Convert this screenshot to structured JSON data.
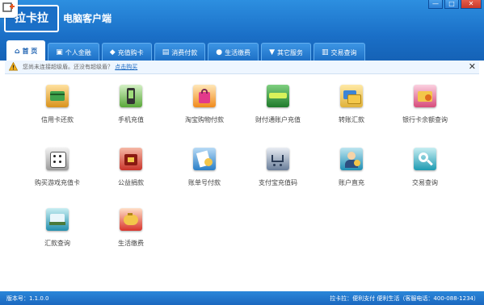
{
  "header": {
    "logo_text": "拉卡拉",
    "app_title": "电脑客户端"
  },
  "window_controls": {
    "minimize": "—",
    "maximize": "□",
    "close": "✕"
  },
  "tabs": [
    {
      "label": "首 页",
      "icon": "home-icon",
      "active": true
    },
    {
      "label": "个人金融",
      "icon": "wallet-icon",
      "active": false
    },
    {
      "label": "充值购卡",
      "icon": "card-icon",
      "active": false
    },
    {
      "label": "消费付款",
      "icon": "payment-icon",
      "active": false
    },
    {
      "label": "生活缴费",
      "icon": "bill-icon",
      "active": false
    },
    {
      "label": "其它服务",
      "icon": "chat-icon",
      "active": false
    },
    {
      "label": "交易查询",
      "icon": "query-icon",
      "active": false
    }
  ],
  "notice": {
    "text": "您尚未连接超级盾。还没有超级盾？",
    "link": "点击购买",
    "close": "✕"
  },
  "services": [
    {
      "label": "信用卡还款",
      "icon": "credit-card-icon",
      "color": "#e2a12c"
    },
    {
      "label": "手机充值",
      "icon": "mobile-icon",
      "color": "#5aa83a"
    },
    {
      "label": "淘宝购物付款",
      "icon": "shopping-bag-icon",
      "color": "#f08a1c"
    },
    {
      "label": "财付通账户充值",
      "icon": "tenpay-icon",
      "color": "#2e9a3b"
    },
    {
      "label": "转账汇款",
      "icon": "transfer-icon",
      "color": "#3c84d6"
    },
    {
      "label": "银行卡余额查询",
      "icon": "balance-icon",
      "color": "#d74c7b"
    },
    {
      "label": "购买游戏充值卡",
      "icon": "dice-icon",
      "color": "#777777"
    },
    {
      "label": "公益捐款",
      "icon": "donation-icon",
      "color": "#c9342a"
    },
    {
      "label": "账单号付款",
      "icon": "bill-pay-icon",
      "color": "#2a7fc7"
    },
    {
      "label": "支付宝充值码",
      "icon": "cart-icon",
      "color": "#6a7e9a"
    },
    {
      "label": "账户直充",
      "icon": "person-icon",
      "color": "#1f8fb4"
    },
    {
      "label": "交易查询",
      "icon": "search-icon",
      "color": "#1e9bb2"
    },
    {
      "label": "汇款查询",
      "icon": "remit-query-icon",
      "color": "#238fae"
    },
    {
      "label": "生活缴费",
      "icon": "piggy-bank-icon",
      "color": "#d8342c"
    }
  ],
  "status": {
    "version": "版本号：1.1.0.0",
    "right": "拉卡拉：便利支付 便利生活（客服电话：400-088-1234）"
  }
}
